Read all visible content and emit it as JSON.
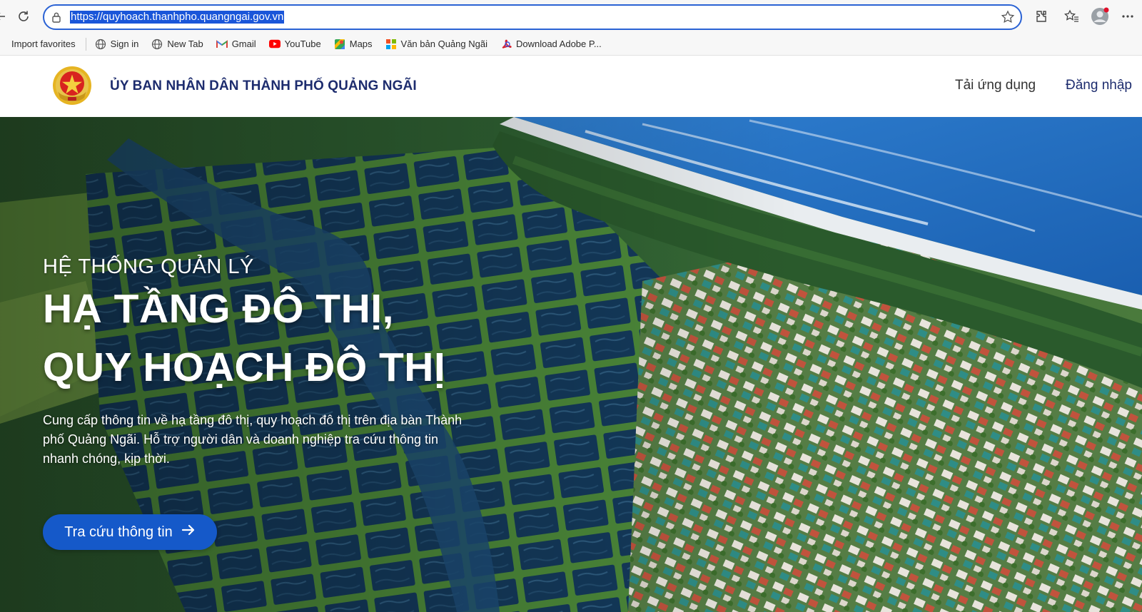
{
  "browser": {
    "url": "https://quyhoach.thanhpho.quangngai.gov.vn",
    "favorites": [
      {
        "label": "Import favorites",
        "icon": "import-icon"
      },
      {
        "label": "Sign in",
        "icon": "globe-icon"
      },
      {
        "label": "New Tab",
        "icon": "globe-icon"
      },
      {
        "label": "Gmail",
        "icon": "gmail-icon"
      },
      {
        "label": "YouTube",
        "icon": "youtube-icon"
      },
      {
        "label": "Maps",
        "icon": "maps-icon"
      },
      {
        "label": "Văn bản Quảng Ngãi",
        "icon": "grid-icon"
      },
      {
        "label": "Download Adobe P...",
        "icon": "adobe-icon"
      }
    ]
  },
  "header": {
    "org_name": "ỦY BAN NHÂN DÂN THÀNH PHỐ QUẢNG NGÃI",
    "nav_download": "Tải ứng dụng",
    "nav_login": "Đăng nhập"
  },
  "hero": {
    "kicker": "HỆ THỐNG QUẢN LÝ",
    "title_line1": "HẠ TẦNG ĐÔ THỊ,",
    "title_line2": "QUY HOẠCH ĐÔ THỊ",
    "description": "Cung cấp thông tin về hạ tầng đô thị, quy hoạch đô thị trên địa bàn Thành phố Quảng Ngãi. Hỗ trợ người dân và doanh nghiệp tra cứu thông tin nhanh chóng, kịp thời.",
    "cta_label": "Tra cứu thông tin"
  },
  "colors": {
    "accent": "#1559c9",
    "brand_text": "#1d2c6e",
    "address_border": "#2a62d4"
  }
}
